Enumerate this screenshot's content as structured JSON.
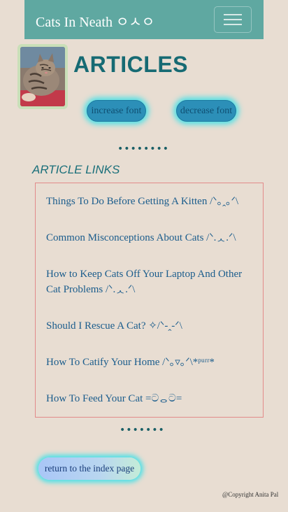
{
  "navbar": {
    "brand": "Cats In Neath ㅇㅅㅇ",
    "toggle_icon": "hamburger-menu-icon"
  },
  "header": {
    "avatar_icon": "cat-photo",
    "title": "ARTICLES",
    "increase_font_label": "increase font",
    "decrease_font_label": "decrease font"
  },
  "dividers": {
    "top": "••••••••",
    "bottom": "•••••••"
  },
  "article_links": {
    "heading": "ARTICLE LINKS",
    "items": [
      {
        "label": "Things To Do Before Getting A Kitten /ᐠ｡ꞈ｡ᐟ\\"
      },
      {
        "label": "Common Misconceptions About Cats /ᐠ.ᆺ.ᐟ\\"
      },
      {
        "label": "How to Keep Cats Off Your Laptop And Other Cat Problems /ᐠ.ᆺ.ᐟ\\"
      },
      {
        "label": "Should I Rescue A Cat? ✧/ᐠ-ꞈ-ᐟ\\"
      },
      {
        "label": "How To Catify Your Home /ᐠ｡▿｡ᐟ\\*ᵖᵘʳʳ*"
      },
      {
        "label": "How To Feed Your Cat =ටᆼට="
      }
    ]
  },
  "footer": {
    "return_label": "return to the index page",
    "copyright": "@Copyright Anita Pal"
  },
  "colors": {
    "background": "#e8ddd2",
    "navbar": "#5fa8a1",
    "title": "#166a73",
    "link": "#1a5c8c",
    "box_border": "#e28a8a",
    "glow": "#53e0e6"
  }
}
